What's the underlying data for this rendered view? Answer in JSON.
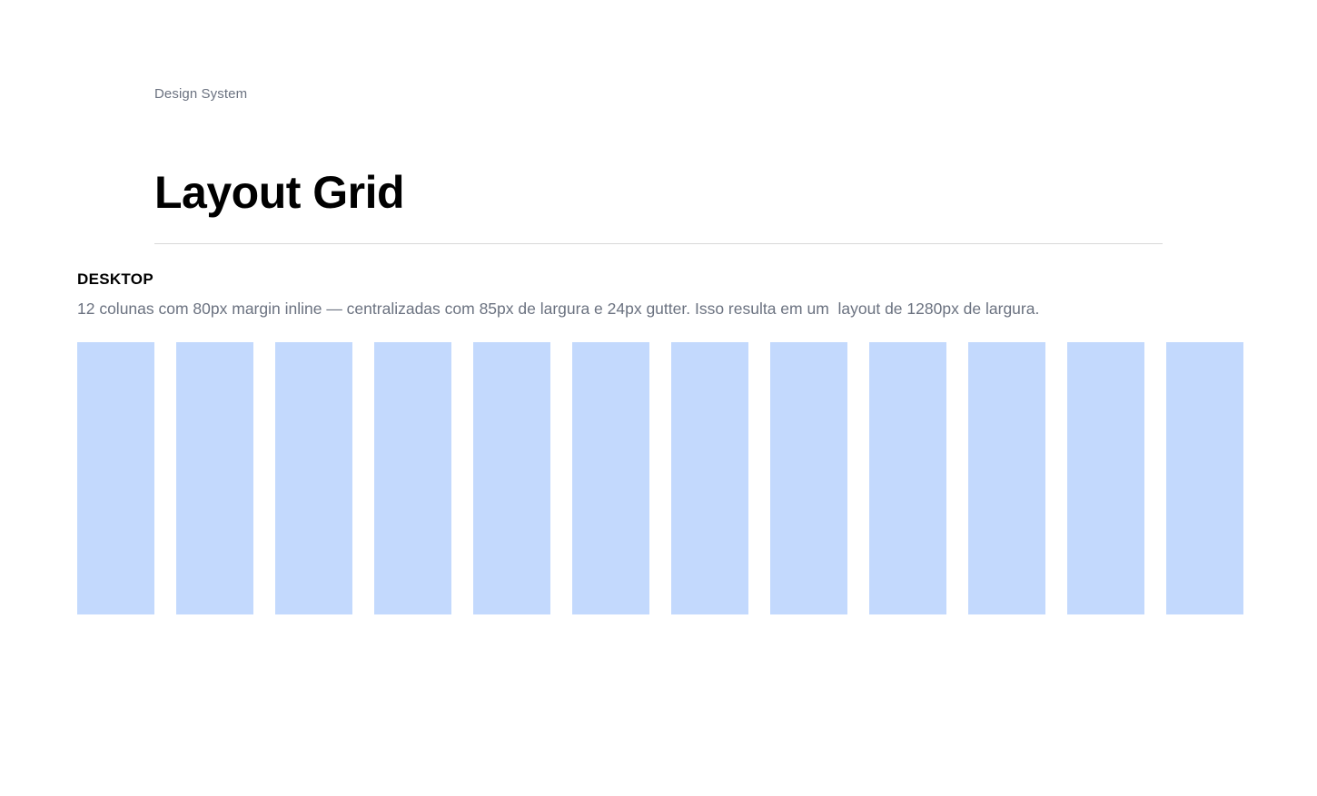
{
  "header": {
    "eyebrow": "Design System",
    "title": "Layout Grid"
  },
  "section": {
    "label": "DESKTOP",
    "description": "12 colunas com 80px margin inline — centralizadas com 85px de largura e 24px gutter. Isso resulta em um  layout de 1280px de largura."
  },
  "grid": {
    "column_count": 12,
    "column_color": "#c3d9fd"
  }
}
